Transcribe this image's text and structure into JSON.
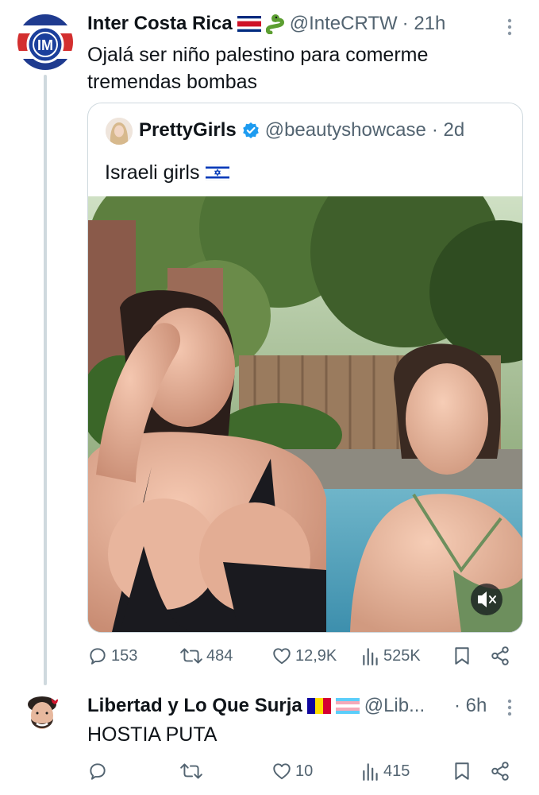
{
  "tweet": {
    "author_name": "Inter Costa Rica",
    "author_handle": "@InteCRTW",
    "time": "· 21h",
    "text": "Ojalá ser niño palestino para comerme tremendas bombas",
    "avatar_icon": "inter-crest-icon",
    "more_icon": "more-vertical-icon"
  },
  "quote": {
    "author_name": "PrettyGirls",
    "author_handle": "@beautyshowcase",
    "time": "· 2d",
    "text": "Israeli girls",
    "media_icon": "mute-speaker-icon"
  },
  "tweet_stats": {
    "replies": "153",
    "retweets": "484",
    "likes": "12,9K",
    "views": "525K"
  },
  "reply": {
    "author_name": "Libertad y Lo Que Surja",
    "author_handle": "@Lib...",
    "time": "· 6h",
    "text": "HOSTIA PUTA",
    "stats": {
      "replies": "",
      "retweets": "",
      "likes": "10",
      "views": "415"
    }
  },
  "colors": {
    "text_primary": "#0f1419",
    "text_secondary": "#536471",
    "border": "#cfd9de",
    "verified": "#1d9bf0"
  }
}
